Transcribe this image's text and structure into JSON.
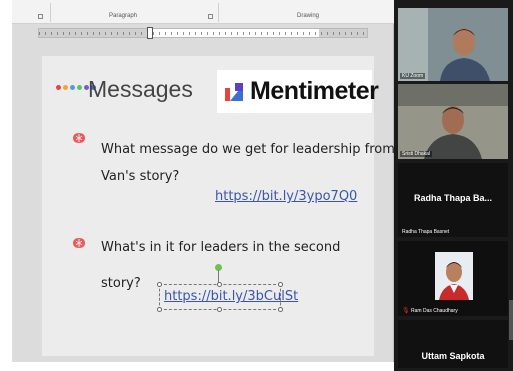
{
  "word": {
    "ribbon": {
      "paragraph_label": "Paragraph",
      "drawing_label": "Drawing"
    }
  },
  "slide": {
    "title": "Messages",
    "dot_colors": [
      "#e8433c",
      "#f3a33a",
      "#4a9ee0",
      "#5bc26a",
      "#7a5bc9",
      "#3c6fd0"
    ],
    "brand": {
      "name": "Mentimeter",
      "logo_colors": [
        "#e8433c",
        "#3c6fd0",
        "#5b3fc9"
      ]
    },
    "questions": [
      {
        "line1": "What message do we get for leadership from Rip",
        "line2": "Van's story?",
        "link": "https://bit.ly/3ypo7Q0"
      },
      {
        "line1": "What's in it for leaders in the second",
        "line2": "story?",
        "link": "https://bit.ly/3bCulSt"
      }
    ],
    "bullet_color": "#e85a5a",
    "link_color": "#3a55b0"
  },
  "zoom": {
    "participants": [
      {
        "label": "KU Zoom"
      },
      {
        "label": "Sristi Dhakal"
      },
      {
        "display_name": "Radha Thapa Ba...",
        "label": "Radha Thapa Basnet"
      },
      {
        "label": "Ram Das Chaudhary",
        "mic_muted": true
      },
      {
        "display_name": "Uttam Sapkota"
      }
    ]
  }
}
